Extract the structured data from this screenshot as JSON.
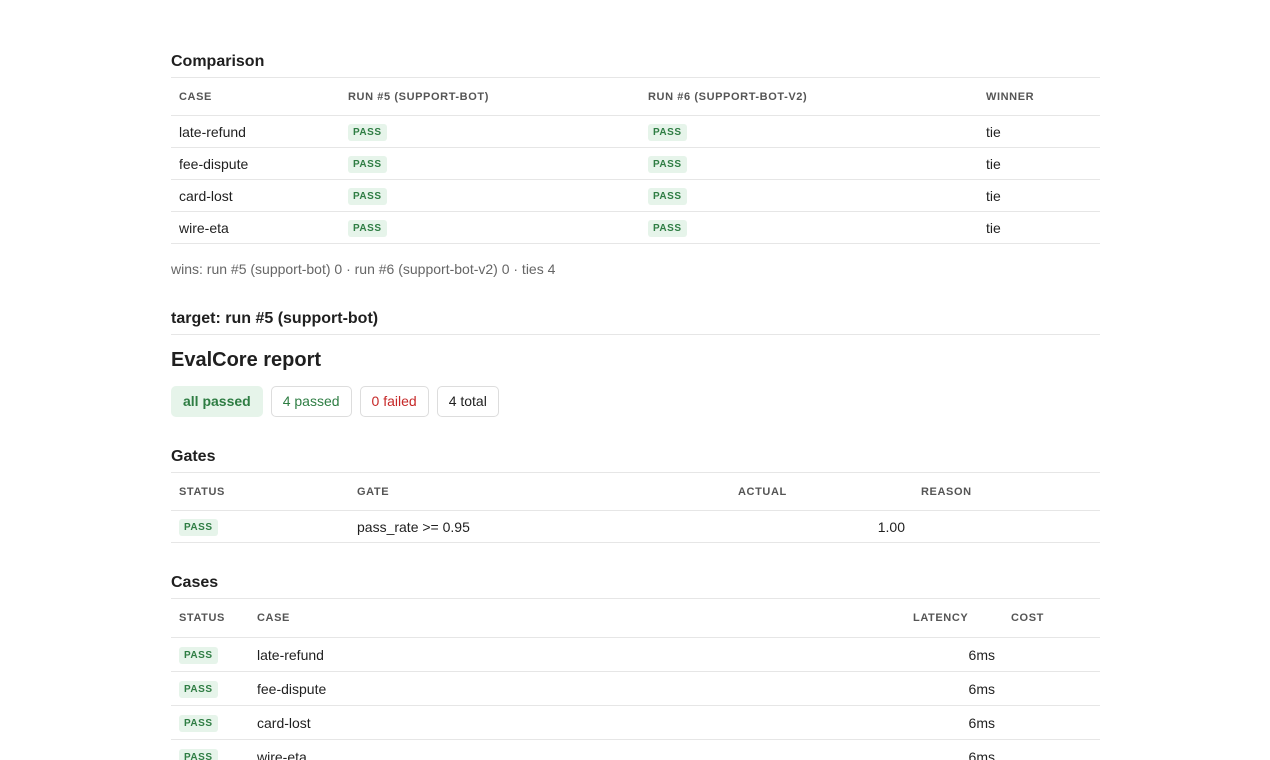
{
  "comparison": {
    "title": "Comparison",
    "headers": {
      "case": "CASE",
      "run_a": "RUN #5 (SUPPORT-BOT)",
      "run_b": "RUN #6 (SUPPORT-BOT-V2)",
      "winner": "WINNER"
    },
    "rows": [
      {
        "case": "late-refund",
        "run_a": "PASS",
        "run_b": "PASS",
        "winner": "tie"
      },
      {
        "case": "fee-dispute",
        "run_a": "PASS",
        "run_b": "PASS",
        "winner": "tie"
      },
      {
        "case": "card-lost",
        "run_a": "PASS",
        "run_b": "PASS",
        "winner": "tie"
      },
      {
        "case": "wire-eta",
        "run_a": "PASS",
        "run_b": "PASS",
        "winner": "tie"
      }
    ],
    "summary": "wins: run #5 (support-bot) 0 · run #6 (support-bot-v2) 0 · ties 4"
  },
  "target": {
    "title": "target: run #5 (support-bot)"
  },
  "report": {
    "title": "EvalCore report",
    "chips": {
      "all_passed": "all passed",
      "passed": "4 passed",
      "failed": "0 failed",
      "total": "4 total"
    }
  },
  "gates": {
    "title": "Gates",
    "headers": {
      "status": "STATUS",
      "gate": "GATE",
      "actual": "ACTUAL",
      "reason": "REASON"
    },
    "rows": [
      {
        "status": "PASS",
        "gate": "pass_rate >= 0.95",
        "actual": "1.00",
        "reason": ""
      }
    ]
  },
  "cases": {
    "title": "Cases",
    "headers": {
      "status": "STATUS",
      "case": "CASE",
      "latency": "LATENCY",
      "cost": "COST"
    },
    "rows": [
      {
        "status": "PASS",
        "case": "late-refund",
        "latency": "6ms",
        "cost": ""
      },
      {
        "status": "PASS",
        "case": "fee-dispute",
        "latency": "6ms",
        "cost": ""
      },
      {
        "status": "PASS",
        "case": "card-lost",
        "latency": "6ms",
        "cost": ""
      },
      {
        "status": "PASS",
        "case": "wire-eta",
        "latency": "6ms",
        "cost": ""
      }
    ]
  },
  "colors": {
    "pass_text": "#2e7d43",
    "pass_bg": "#e6f4ea",
    "fail_text": "#c62828",
    "border": "#e6e6e6"
  }
}
